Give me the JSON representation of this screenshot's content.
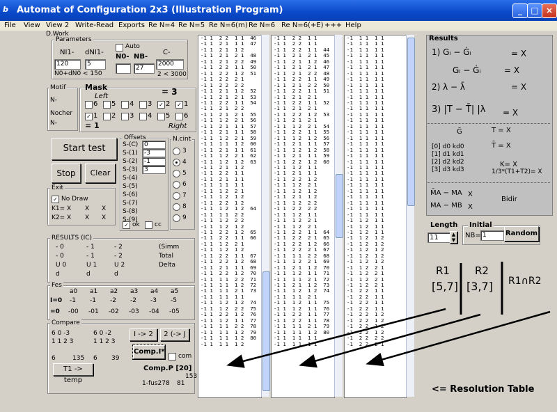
{
  "window": {
    "title": "Automat of Configuration 2x3 (Illustration Program)",
    "icon_text": "b"
  },
  "menu": [
    "File",
    "View",
    "View 2",
    "Write-Read",
    "Exports",
    "Re N=4",
    "Re N=5",
    "Re N=6(m)",
    "Re N=6",
    "Re N=6(+E)",
    "+++",
    "Help"
  ],
  "work_label": "D.Work",
  "parameters": {
    "label": "Parameters",
    "n_label": "NI1-",
    "dn_label": "dNI1-",
    "auto_label": "Auto",
    "n0_label": "N0-",
    "nb_label": "NB-",
    "c_label": "C-",
    "n_value": "120",
    "dn_value": "5",
    "n0_value": "",
    "nb_value": "27",
    "c_value": "2000",
    "note1": "N0+dN0 < 150",
    "note2": "2 < 3000"
  },
  "motif": {
    "label": "Motif",
    "line1": "N-",
    "line2": "Nocher",
    "line3": "N-"
  },
  "mask": {
    "label": "Mask",
    "left": "Left",
    "right": "Right",
    "equals": "= 3",
    "row1": [
      "6",
      "5",
      "4",
      "3",
      "2",
      "1"
    ],
    "row2": [
      "1",
      "2",
      "3",
      "4",
      "5",
      "6"
    ],
    "eq1": "= 1"
  },
  "buttons": {
    "start": "Start test",
    "stop": "Stop",
    "clear": "Clear",
    "i2": "I -> 2",
    "i2b": "2 (-> J",
    "comp_i": "Comp.I*",
    "comp_p": "Comp.P [20]",
    "to_temp": "T1 -> temp",
    "random": "Random"
  },
  "offsets": {
    "label": "Offsets",
    "rows": [
      "S-(C)",
      "S-(1)",
      "S-(2)",
      "S-(3)",
      "S-(4)",
      "S-(5)",
      "S-(6)",
      "S-(7)",
      "S-(8)",
      "S-(9)"
    ],
    "values": [
      "0",
      "-3",
      "-1",
      "3"
    ],
    "ok": "ok",
    "cc": "cc"
  },
  "ncount": {
    "label": "N.cint",
    "values": [
      "3",
      "4",
      "5",
      "6",
      "7",
      "8",
      "9"
    ],
    "selected": "4"
  },
  "exit": {
    "label": "Exit",
    "no_draw": "No Draw",
    "k1": "K1= X",
    "k2": "K2= X",
    "x": "X"
  },
  "results_ic": {
    "label": "RESULTS (IC)",
    "row1": [
      "- 0",
      "- 1",
      "- 2",
      "(Simm"
    ],
    "row2": [
      "- 0",
      "- 1",
      "- 2",
      "Total"
    ],
    "row3": [
      "U 0",
      "U 1",
      "U 2",
      "Delta"
    ],
    "row4": [
      "d",
      "d",
      "d"
    ]
  },
  "fes": {
    "label": "Fes",
    "header": [
      "a0",
      "a1",
      "a2",
      "a3",
      "a4",
      "a5"
    ],
    "row1_label": "I=0",
    "row1": [
      "-1",
      "-1",
      "-2",
      "-2",
      "-3",
      "-5"
    ],
    "row2_label": "=0",
    "row2": [
      "-00",
      "-01",
      "-02",
      "-03",
      "-04",
      "-05"
    ]
  },
  "compare": {
    "label": "Compare",
    "line1": "6 0 -3",
    "line2": "1 1 2 3",
    "line3": "6 0 -2",
    "line4": "1 1 2 3",
    "n1": "6",
    "n2": "135",
    "n3": "6",
    "n4": "39",
    "com_label": "com",
    "t_label": "1-fus278",
    "b_label": "81",
    "num153": "153"
  },
  "results": {
    "label": "Results",
    "l1": "1) Gᵢ − Ġᵢ",
    "l1v": "= X",
    "l2": "Gᵢ − Ġᵢ",
    "l2v": "= X",
    "l3": "2)   λ − λ̄",
    "l3v": "= X",
    "l4": "3)  |T − T̄|  |λ",
    "l4v": "= X",
    "sub1": "Ḡ",
    "sub2": "T = X",
    "sub3": "T̄ = X",
    "rows": [
      "[0]   d0   kd0",
      "[1]   d1   kd1",
      "[2]   d2   kd2",
      "[3]   d3   kd3"
    ],
    "k": "K= X",
    "avg": "1/3*(T1+T2)= X",
    "m1": "M̄A − MA",
    "m2": "MA − MB",
    "mx": "X",
    "bidir": "Bidir"
  },
  "length": {
    "label": "Length",
    "value": "11",
    "initial_label": "Initial",
    "nb_label": "NB=",
    "nb_value": "1"
  },
  "annotation": {
    "r1": "R1",
    "r1_range": "[5,7]",
    "r2": "R2",
    "r2_range": "[3,7]",
    "r12": "R1∩R2",
    "resolution": "<= Resolution Table"
  },
  "columns": {
    "col1": [
      "-1 1  2 2  1 1  46",
      "-1 1  2 1  1 1  47",
      "-1 1  2 1  1 2",
      "-1 1  2 1  2 1  48",
      "-1 1  2 1  2 2  49",
      "-1 1  2 2  1 1  50",
      "-1 1  2 2  1 2  51",
      "-1 1  2 2  2 1",
      "-1 1  2 2  2 2",
      "-1 1  2 1  1 2  52",
      "-1 1  2 1  2 1  53",
      "-1 1  2 2  1 1  54",
      "-1 1  2 1  2 2",
      "-1 1  2 1  2 1  55",
      "-1 1  1 2  2 1  56",
      "-1 1  2 1  1 1  57",
      "-1 1  2 1  1 1  58",
      "-1 1  1 2  2 1  59",
      "-1 1  1 1  1 2  60",
      "-1 1  2 1  1 1  61",
      "-1 1  1 2  2 1  62",
      "-1 1  1 2  1 2  63",
      "-1 1  2 1  1 2",
      "-1 1  2 2  1 1",
      "-1 1  2 1  1 1",
      "-1 1  1 1  1 1",
      "-1 1  1 2  2 1",
      "-1 1  1 2  1 2",
      "-1 1  2 2  1 2",
      "-1 1  1 2  1 2  64",
      "-1 1  1 1  2 2",
      "-1 1  1 2  2 2",
      "-1 1  1 2  1 2",
      "-1 1  2 2  1 2  65",
      "-1 1  2 2  1 1  66",
      "-1 1  1 2  2 1",
      "-1 1  1 2  1 2",
      "-1 1  2 2  1 1  67",
      "-1 1  2 2  1 2  68",
      "-1 1  2 1  1 1  69",
      "-1 1  2 2  1 2  70",
      "-1 1  1 1  2 2  71",
      "-1 1  1 1  1 2  72",
      "-1 1  1 1  2 1  73",
      "-1 1  1 1  1 1",
      "-1 1  1 2  1 2  74",
      "-1 1  1 2  2 2  75",
      "-1 1  2 2  1 2  76",
      "-1 1  1 2  1 1  77",
      "-1 1  1 1  2 2  78",
      "-1 1  1 1  1 2  79",
      "-1 1  1 1  1 2  80",
      "-1 1  1 1  1 2"
    ],
    "col2": [
      "-1 1  2 2  1 1",
      "-1 1  2 2  1 1",
      "-1 1  2 2  1 1  44",
      "-1 1  2 1  2 1  45",
      "-1 1  2 1  1 2  46",
      "-1 1  2 1  2 1  47",
      "-1 1  2 1  2 2  48",
      "-1 1  2 2  1 1  49",
      "-1 1  2 1  2 2  50",
      "-1 1  2 2  1 1  51",
      "-1 1  2 1  2 1",
      "-1 1  2 2  1 1  52",
      "-1 1  2 1  2 1",
      "-1 1  2 2  1 2  53",
      "-1 1  2 1  2 1",
      "-1 1  1 2  2 1  54",
      "-1 1  2 2  1 1  55",
      "-1 1  1 2  1 2  56",
      "-1 1  2 1  1 1  57",
      "-1 1  1 2  1 2  58",
      "-1 1  2 1  1 1  59",
      "-1 1  2 2  1 2  60",
      "-1 1  1 2  1 1",
      "-1 1  2 1  1 1",
      "-1 1  2 2  1 2",
      "-1 1  1 2  2 1",
      "-1 1  1 2  1 2",
      "-1 1  2 1  1 2",
      "-1 1  1 2  2 2",
      "-1 1  2 2  2 2",
      "-1 1  1 2  1 1",
      "-1 1  1 2  2 1",
      "-1 1  1 2  2 1",
      "-1 1  2 2  1 1  64",
      "-1 1  2 2  2 1  65",
      "-1 1  2 2  1 2  66",
      "-1 1  2 2  2 1  67",
      "-1 1  1 1  2 2  68",
      "-1 1  1 2  2 1  69",
      "-1 1  2 1  1 2  70",
      "-1 1  1 2  1 1  71",
      "-1 1  1 1  2 1  72",
      "-1 1  2 1  1 2  73",
      "-1 1  1 2  1 2  74",
      "-1 1  1 1  2 1",
      "-1 1  1 2  1 1  75",
      "-1 1  1 2  1 1  76",
      "-1 1  2 2  1 1  77",
      "-1 1  2 2  1 1  78",
      "-1 1  1 1  2 1  79",
      "-1 1  1 1  1 2  80",
      "-1 1  1 1  1 1",
      "-1 1  1 1  1 1"
    ],
    "col3": [
      "-1  1 1  1 1",
      "-1  1 1  1 1",
      "-1  1 1  1 1",
      "-1  1 1  1 1",
      "-1  1 1  1 1",
      "-1  1 1  1 1",
      "-1  1 1  1 1",
      "-1  1 1  1 1",
      "-1  1 1  1 1",
      "-1  1 1  1 1",
      "-1  1 1  1 1",
      "-1  1 1  1 1",
      "-1  1 1  1 1",
      "-1  1 1  1 1",
      "-1  1 1  1 1",
      "-1  1 1  1 1",
      "-1  1 1  1 1",
      "-1  1 1  1 1",
      "-1  1 1  1 1",
      "-1  1 1  1 1",
      "-1  1 1  1 1",
      "-1  1 1  1 1",
      "-1  1 1  1 1",
      "-1  1 1  1 1",
      "-1  1 1  1 1",
      "-1  1 1  1 1",
      "-1  1 1  1 1",
      "-1  1 1  1 1",
      "-1  1 1  1 1",
      "-1  1 1  1 1",
      "-1  1 1  1 1",
      "-1  1 2  1 1",
      "-1  1 2  1 1",
      "-1  1 2  1 1",
      "-1  1 2  1 2",
      "-1  1 2  1 2",
      "-1  1 2  1 2",
      "-1  1 2  1 2",
      "-1  1 2  1 2",
      "-1  1 2  2 1",
      "-1  1 2  2 1",
      "-1  1 2  2 1",
      "-1  1 2  2 1",
      "-1  2 2  1 1",
      "-1  2 2  1 1",
      "-1  2 2  1 1",
      "-1  2 2  1 1",
      "-1  2 2  1 2",
      "-1  2 2  1 2",
      "-1  2 2  1 2",
      "-1  2 2  1 2",
      "-1  2 2  2 2",
      "-1  2 2  2 1"
    ]
  }
}
